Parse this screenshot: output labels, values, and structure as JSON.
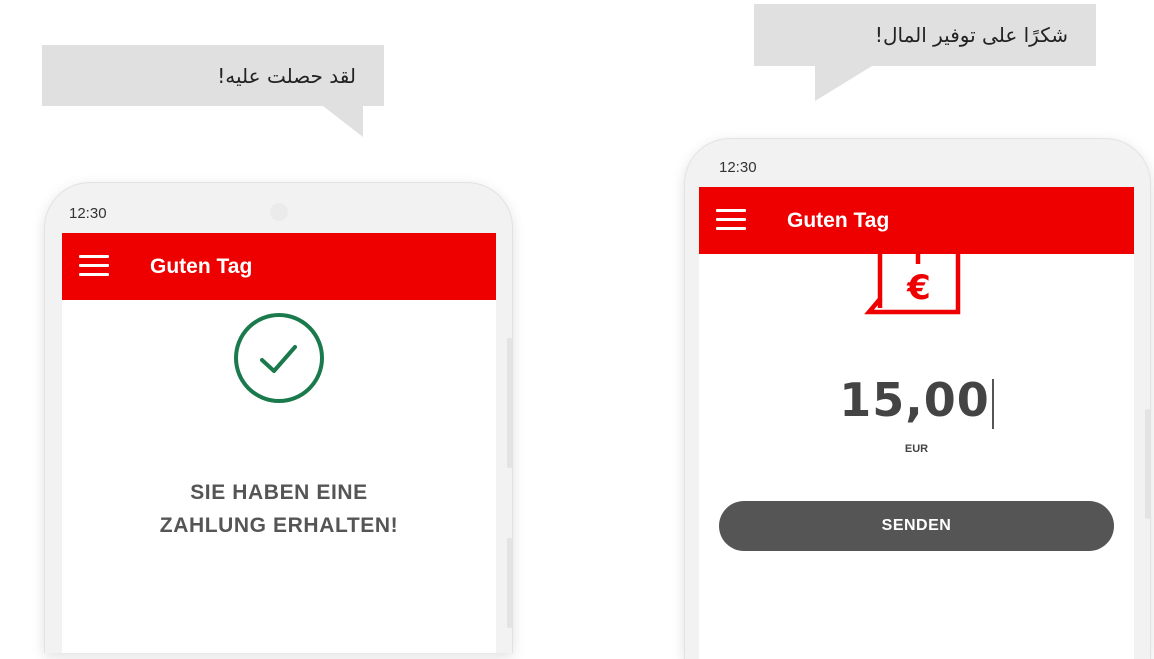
{
  "bubbles": {
    "left": "لقد حصلت عليه!",
    "right": "شكرًا على توفير المال!"
  },
  "phone_left": {
    "status_time": "12:30",
    "appbar": {
      "title": "Guten Tag",
      "menu_icon": "hamburger-menu-icon"
    },
    "status_icon": "check-circle-icon",
    "message_lines": [
      "SIE HABEN EINE",
      "ZAHLUNG ERHALTEN!"
    ]
  },
  "phone_right": {
    "status_time": "12:30",
    "appbar": {
      "title": "Guten Tag",
      "menu_icon": "hamburger-menu-icon"
    },
    "send_icon": "send-money-euro-icon",
    "amount": "15,00",
    "currency": "EUR",
    "send_button": "SENDEN"
  },
  "colors": {
    "brand_red": "#ee0000",
    "success_green": "#1a7a4c",
    "button_gray": "#555555",
    "bubble_gray": "#e0e0e0"
  }
}
